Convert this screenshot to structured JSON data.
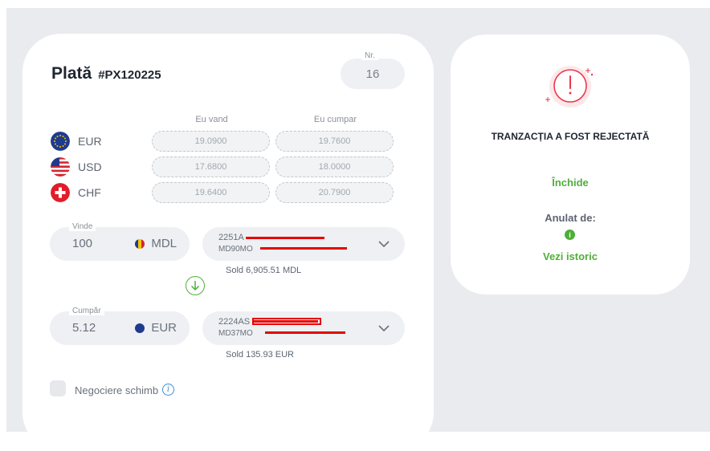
{
  "payment": {
    "title": "Plată",
    "code": "#PX120225",
    "nr_label": "Nr.",
    "nr_value": "16"
  },
  "rates": {
    "col_sell": "Eu vand",
    "col_buy": "Eu cumpar",
    "rows": [
      {
        "currency": "EUR",
        "flag": "eu-flag-icon",
        "sell": "19.0900",
        "buy": "19.7600"
      },
      {
        "currency": "USD",
        "flag": "us-flag-icon",
        "sell": "17.6800",
        "buy": "18.0000"
      },
      {
        "currency": "CHF",
        "flag": "ch-flag-icon",
        "sell": "19.6400",
        "buy": "20.7900"
      }
    ]
  },
  "sell": {
    "label": "Vinde",
    "amount": "100",
    "currency": "MDL",
    "account_line1": "2251A",
    "account_line2": "MD90MO",
    "balance": "Sold 6,905.51 MDL"
  },
  "buy": {
    "label": "Cumpăr",
    "amount": "5.12",
    "currency": "EUR",
    "account_line1": "2224AS",
    "account_line2": "MD37MO",
    "balance": "Sold 135.93 EUR"
  },
  "negotiation": {
    "label": "Negociere schimb"
  },
  "status": {
    "title": "TRANZACȚIA A FOST REJECTATĂ",
    "close": "Închide",
    "cancelled_by": "Anulat de:",
    "history": "Vezi istoric"
  },
  "colors": {
    "accent_green": "#4fae3a",
    "error_red": "#e8394b",
    "background": "#e9ebef"
  }
}
